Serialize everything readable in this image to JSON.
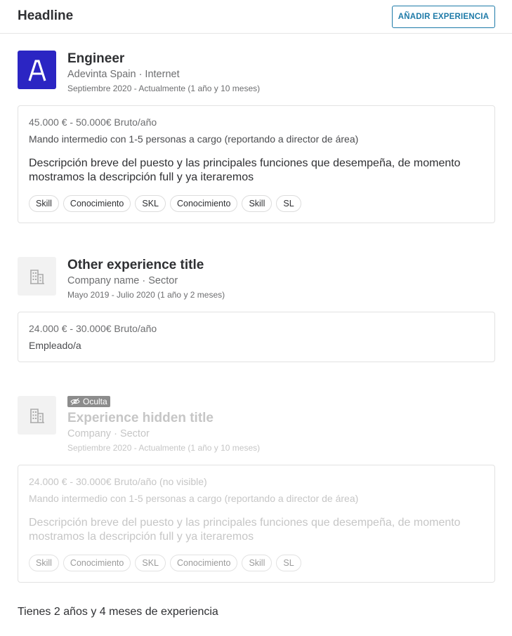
{
  "header": {
    "title": "Headline",
    "add_button": "AÑADIR EXPERIENCIA"
  },
  "experiences": [
    {
      "logo_letter": "A",
      "logo_color": "#2b25c3",
      "title": "Engineer",
      "company": "Adevinta Spain · Internet",
      "dates": "Septiembre 2020 - Actualmente (1 año y 10 meses)",
      "salary": "45.000 € - 50.000€ Bruto/año",
      "role": "Mando intermedio con 1-5 personas a cargo (reportando a director de área)",
      "description": "Descripción breve del puesto y las principales funciones que desempeña, de momento mostramos la descripción full y ya iteraremos",
      "skills": [
        "Skill",
        "Conocimiento",
        "SKL",
        "Conocimiento",
        "Skill",
        "SL"
      ]
    },
    {
      "logo_icon": "building-icon",
      "title": "Other experience title",
      "company": "Company name · Sector",
      "dates": "Mayo 2019 - Julio 2020 (1 año y 2 meses)",
      "salary": "24.000 € - 30.000€ Bruto/año",
      "role": "Empleado/a"
    },
    {
      "logo_icon": "building-icon",
      "badge": "Oculta",
      "badge_icon": "eye-slash-icon",
      "title": "Experience hidden title",
      "company": "Company · Sector",
      "dates": "Septiembre 2020 - Actualmente (1 año y 10 meses)",
      "salary": "24.000 € - 30.000€ Bruto/año (no visible)",
      "role": "Mando intermedio con 1-5 personas a cargo (reportando a director de área)",
      "description": "Descripción breve del puesto y las principales funciones que desempeña, de momento mostramos la descripción full y ya iteraremos",
      "skills": [
        "Skill",
        "Conocimiento",
        "SKL",
        "Conocimiento",
        "Skill",
        "SL"
      ]
    }
  ],
  "summary": "Tienes 2 años y 4 meses de experiencia",
  "colors": {
    "accent": "#1d7aa8",
    "brand_logo": "#2b25c3",
    "muted_text": "#c6c6c6"
  }
}
